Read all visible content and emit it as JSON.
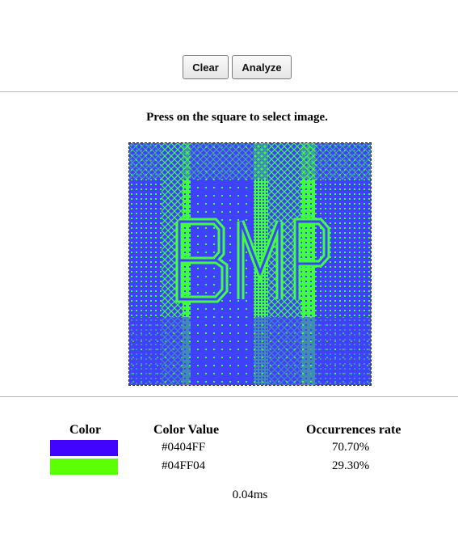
{
  "toolbar": {
    "clear_label": "Clear",
    "analyze_label": "Analyze"
  },
  "instruction": "Press on the square to select image.",
  "image": {
    "text": "BMP",
    "colors": {
      "primary": "#4040FF",
      "secondary": "#40FF40"
    }
  },
  "results": {
    "headers": {
      "color": "Color",
      "value": "Color Value",
      "rate": "Occurrences rate"
    },
    "rows": [
      {
        "swatch": "#4004FF",
        "value": "#0404FF",
        "rate": "70.70%"
      },
      {
        "swatch": "#5CFF04",
        "value": "#04FF04",
        "rate": "29.30%"
      }
    ]
  },
  "timing": "0.04ms"
}
